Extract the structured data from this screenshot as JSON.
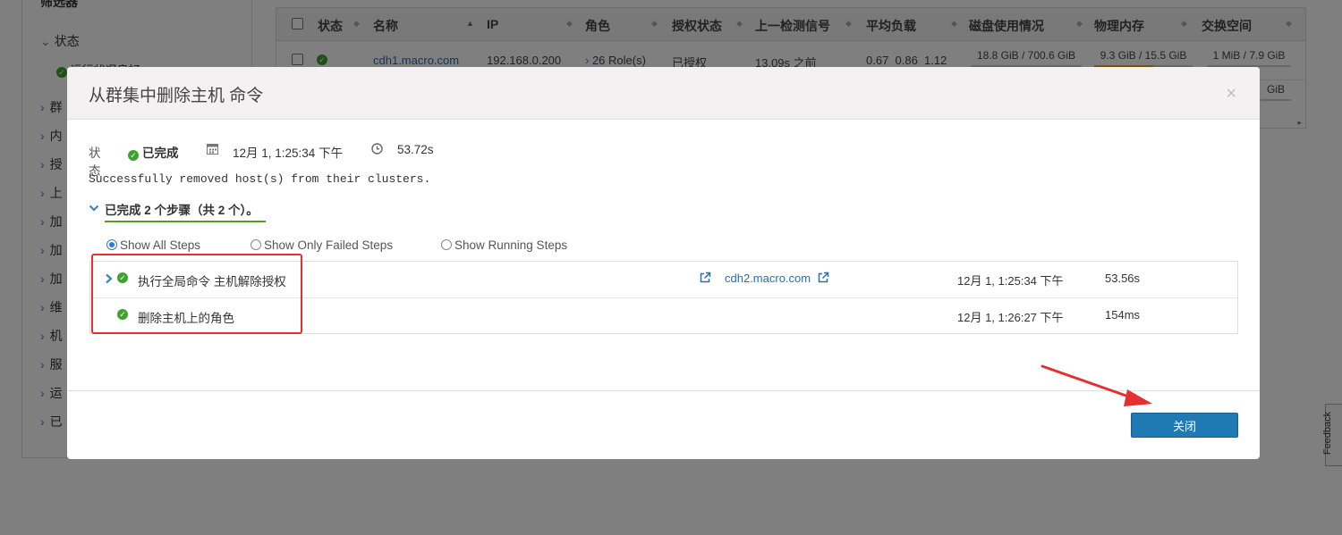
{
  "background": {
    "sidebar": {
      "filter_title": "筛选器",
      "status_label": "状态",
      "sub_item": "运行状况良好",
      "nav_items": [
        "群",
        "内",
        "授",
        "上",
        "加",
        "加",
        "加",
        "维",
        "机",
        "服",
        "运",
        "已"
      ]
    },
    "table": {
      "headers": [
        "状态",
        "名称",
        "IP",
        "角色",
        "授权状态",
        "上一检测信号",
        "平均负载",
        "磁盘使用情况",
        "物理内存",
        "交换空间"
      ],
      "row": {
        "name": "cdh1.macro.com",
        "ip": "192.168.0.200",
        "roles": "26 Role(s)",
        "auth": "已授权",
        "heartbeat": "13.09s 之前",
        "load": "0.67  0.86  1.12",
        "disk": "18.8 GiB / 700.6 GiB",
        "memory": "9.3 GiB / 15.5 GiB",
        "memory_fraction": 0.6,
        "swap": "1 MiB / 7.9 GiB"
      },
      "row2_swap_fragment": "GiB"
    },
    "feedback": "Feedback"
  },
  "modal": {
    "title": "从群集中删除主机 命令",
    "close_symbol": "×",
    "status_label": "状态",
    "status_value": "已完成",
    "start_time": "12月 1, 1:25:34 下午",
    "duration": "53.72s",
    "result_message": "Successfully removed host(s) from their clusters.",
    "steps_summary": "已完成 2 个步骤（共 2 个）。",
    "filters": [
      {
        "label": "Show All Steps",
        "selected": true
      },
      {
        "label": "Show Only Failed Steps",
        "selected": false
      },
      {
        "label": "Show Running Steps",
        "selected": false
      }
    ],
    "steps": [
      {
        "name": "执行全局命令 主机解除授权",
        "host": "cdh2.macro.com",
        "time": "12月 1, 1:25:34 下午",
        "duration": "53.56s",
        "expandable": true
      },
      {
        "name": "删除主机上的角色",
        "host": "",
        "time": "12月 1, 1:26:27 下午",
        "duration": "154ms",
        "expandable": false
      }
    ],
    "close_button": "关闭"
  },
  "colors": {
    "success": "#3ea32e",
    "link": "#2a6fb0",
    "primary_button": "#1f7ab3",
    "annotation": "#e53030"
  }
}
